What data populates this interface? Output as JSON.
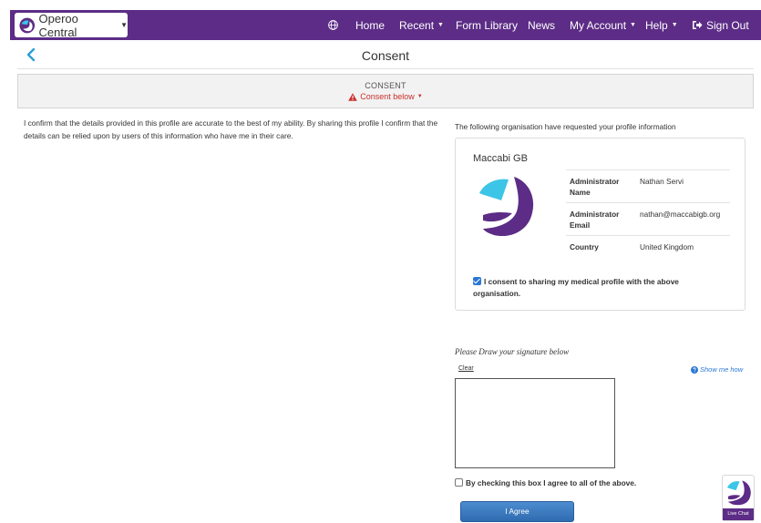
{
  "navbar": {
    "brand": "Operoo Central",
    "items": [
      {
        "label": "Home",
        "has_caret": false
      },
      {
        "label": "Recent",
        "has_caret": true
      },
      {
        "label": "Form Library",
        "has_caret": false
      },
      {
        "label": "News",
        "has_caret": false
      },
      {
        "label": "My Account",
        "has_caret": true
      },
      {
        "label": "Help",
        "has_caret": true
      },
      {
        "label": "Sign Out",
        "icon": "sign-out-icon"
      }
    ],
    "caret_glyph": "▼",
    "globe_icon": "globe-icon",
    "color": "#5c2c86"
  },
  "page": {
    "title": "Consent",
    "back_icon": "chevron-left-icon"
  },
  "consent_bar": {
    "label": "CONSENT",
    "link": "Consent below",
    "warning_icon": "warning-triangle-icon",
    "link_color": "#c9302c"
  },
  "statement": "I confirm that the details provided in this profile are accurate to the best of my ability. By sharing this profile I confirm that the details can be relied upon by users of this information who have me in their care.",
  "request": {
    "intro": "The following organisation have requested your profile information",
    "org_name": "Maccabi GB",
    "details": [
      {
        "key": "Administrator Name",
        "value": "Nathan Servi"
      },
      {
        "key": "Administrator Email",
        "value": "nathan@maccabigb.org"
      },
      {
        "key": "Country",
        "value": "United Kingdom"
      }
    ],
    "consent_label": "I consent to sharing my medical profile with the above organisation.",
    "consent_checked": true
  },
  "signature": {
    "label": "Please Draw your signature below",
    "clear": "Clear",
    "show_me": "Show me how"
  },
  "agreement": {
    "label": "By checking this box I agree to all of the above.",
    "checked": false,
    "button": "I Agree",
    "button_color": "#2f6bb0"
  },
  "livechat": {
    "label": "Live Chat"
  }
}
